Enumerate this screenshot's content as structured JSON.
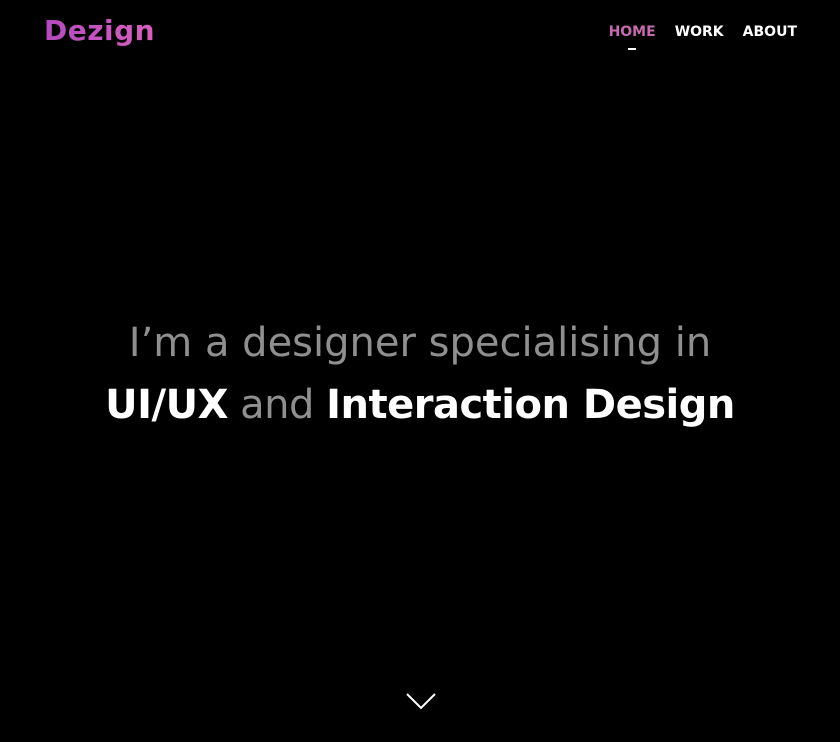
{
  "header": {
    "logo_text": "Dezign",
    "nav": {
      "home": "HOME",
      "work": "WORK",
      "about": "ABOUT"
    }
  },
  "hero": {
    "line1": "I’m a designer specialising in",
    "line2_part1": "UI/UX",
    "line2_connector": " and ",
    "line2_part2": "Interaction Design"
  },
  "colors": {
    "background": "#000000",
    "brand": "#c05ab8",
    "nav_active": "#c76ab0",
    "text_muted": "#8f8f8f",
    "text_strong": "#ffffff"
  },
  "icons": {
    "scroll": "chevron-down-icon"
  }
}
